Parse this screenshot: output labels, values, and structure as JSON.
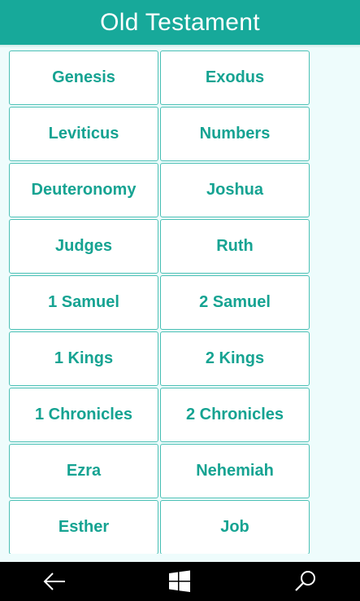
{
  "header": {
    "title": "Old Testament"
  },
  "books": [
    "Genesis",
    "Exodus",
    "Leviticus",
    "Numbers",
    "Deuteronomy",
    "Joshua",
    "Judges",
    "Ruth",
    "1 Samuel",
    "2 Samuel",
    "1 Kings",
    "2 Kings",
    "1 Chronicles",
    "2 Chronicles",
    "Ezra",
    "Nehemiah",
    "Esther",
    "Job"
  ],
  "navbar": {
    "back_icon": "back-arrow-icon",
    "home_icon": "windows-logo-icon",
    "search_icon": "search-icon"
  },
  "colors": {
    "accent": "#17a99a",
    "button_text": "#16a392",
    "button_border": "#4bc0b5",
    "background": "#eefcfc"
  }
}
